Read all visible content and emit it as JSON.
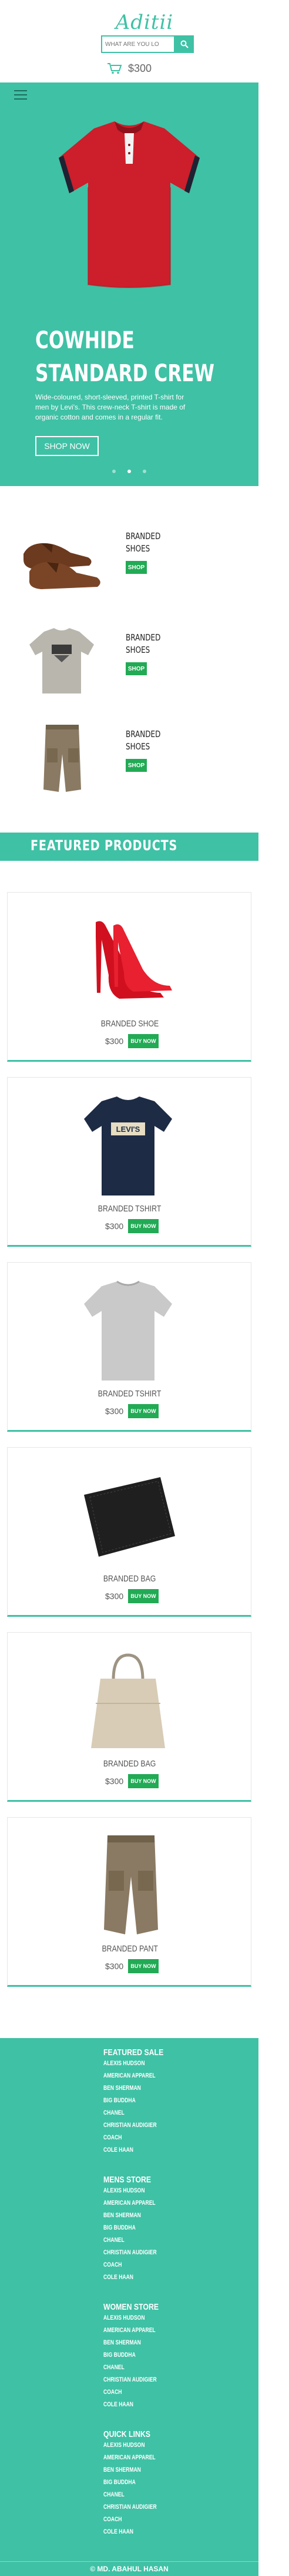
{
  "header": {
    "logo": "Aditii",
    "search_placeholder": "WHAT ARE YOU LO",
    "cart_total": "$300"
  },
  "hero": {
    "title_line1": "COWHIDE",
    "title_line2": "STANDARD CREW",
    "description": "Wide-coloured, short-sleeved, printed T-shirt for men by Levi's. This crew-neck T-shirt is made of organic cotton and comes in a regular fit.",
    "button": "SHOP NOW"
  },
  "branded": [
    {
      "label1": "BRANDED",
      "label2": "SHOES",
      "button": "SHOP"
    },
    {
      "label1": "BRANDED",
      "label2": "SHOES",
      "button": "SHOP"
    },
    {
      "label1": "BRANDED",
      "label2": "SHOES",
      "button": "SHOP"
    }
  ],
  "featured": {
    "title": "FEATURED PRODUCTS",
    "products": [
      {
        "name": "BRANDED SHOE",
        "price": "$300",
        "button": "BUY NOW"
      },
      {
        "name": "BRANDED TSHIRT",
        "price": "$300",
        "button": "BUY NOW"
      },
      {
        "name": "BRANDED TSHIRT",
        "price": "$300",
        "button": "BUY NOW"
      },
      {
        "name": "BRANDED BAG",
        "price": "$300",
        "button": "BUY NOW"
      },
      {
        "name": "BRANDED BAG",
        "price": "$300",
        "button": "BUY NOW"
      },
      {
        "name": "BRANDED PANT",
        "price": "$300",
        "button": "BUY NOW"
      }
    ]
  },
  "footer": {
    "sections": [
      {
        "heading": "FEATURED SALE",
        "links": [
          "ALEXIS HUDSON",
          "AMERICAN APPAREL",
          "BEN SHERMAN",
          "BIG BUDDHA",
          "CHANEL",
          "CHRISTIAN AUDIGIER",
          "COACH",
          "COLE HAAN"
        ]
      },
      {
        "heading": "MENS STORE",
        "links": [
          "ALEXIS HUDSON",
          "AMERICAN APPAREL",
          "BEN SHERMAN",
          "BIG BUDDHA",
          "CHANEL",
          "CHRISTIAN AUDIGIER",
          "COACH",
          "COLE HAAN"
        ]
      },
      {
        "heading": "WOMEN STORE",
        "links": [
          "ALEXIS HUDSON",
          "AMERICAN APPAREL",
          "BEN SHERMAN",
          "BIG BUDDHA",
          "CHANEL",
          "CHRISTIAN AUDIGIER",
          "COACH",
          "COLE HAAN"
        ]
      },
      {
        "heading": "QUICK LINKS",
        "links": [
          "ALEXIS HUDSON",
          "AMERICAN APPAREL",
          "BEN SHERMAN",
          "BIG BUDDHA",
          "CHANEL",
          "CHRISTIAN AUDIGIER",
          "COACH",
          "COLE HAAN"
        ]
      }
    ],
    "copyright": "© MD. ABAHUL HASAN"
  },
  "colors": {
    "accent": "#3fc1a5",
    "shop_green": "#22aa55",
    "hero_shirt": "#cc1e2b"
  }
}
